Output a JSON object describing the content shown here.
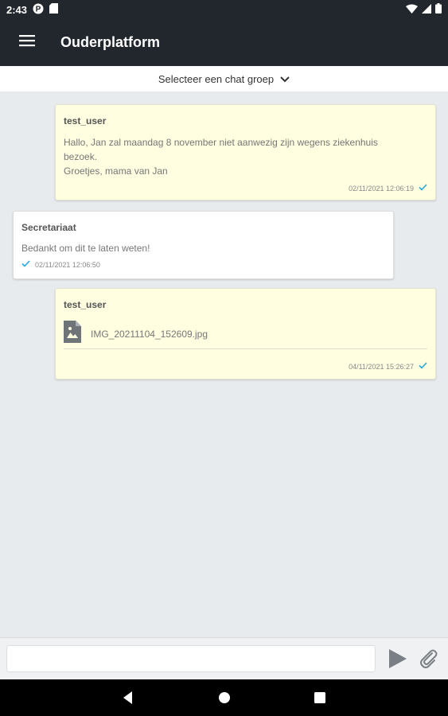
{
  "status_bar": {
    "time": "2:43",
    "icons": [
      "p-badge-icon",
      "sd-card-icon",
      "wifi-icon",
      "signal-icon",
      "battery-icon"
    ]
  },
  "app_bar": {
    "title": "Ouderplatform",
    "menu_icon": "hamburger-menu-icon"
  },
  "group_selector": {
    "label": "Selecteer een chat groep",
    "icon": "chevron-down-icon"
  },
  "messages": [
    {
      "author": "test_user",
      "lines": [
        "Hallo, Jan zal maandag 8 november niet aanwezig zijn wegens ziekenhuis",
        "bezoek.",
        "Groetjes, mama van Jan"
      ],
      "timestamp": "02/11/2021 12:06:19",
      "status_icon": "check-icon",
      "own": true
    },
    {
      "author": "Secretariaat",
      "lines": [
        "Bedankt om dit te laten weten!"
      ],
      "timestamp": "02/11/2021 12:06:50",
      "status_icon": "check-icon",
      "own": false
    },
    {
      "author": "test_user",
      "attachment": {
        "filename": "IMG_20211104_152609.jpg",
        "icon": "image-file-icon"
      },
      "timestamp": "04/11/2021 15:26:27",
      "status_icon": "check-icon",
      "own": true
    }
  ],
  "input_bar": {
    "value": "",
    "placeholder": "",
    "send_icon": "send-icon",
    "attach_icon": "paperclip-icon"
  },
  "nav_bar": {
    "icons": [
      "back-icon",
      "home-icon",
      "recents-icon"
    ]
  },
  "colors": {
    "app_bar": "#22262d",
    "own_bubble": "#fffee0",
    "other_bubble": "#ffffff",
    "chat_background": "#e8ebee",
    "check_accent": "#29a8e0",
    "icon_gray": "#7a7f85"
  }
}
